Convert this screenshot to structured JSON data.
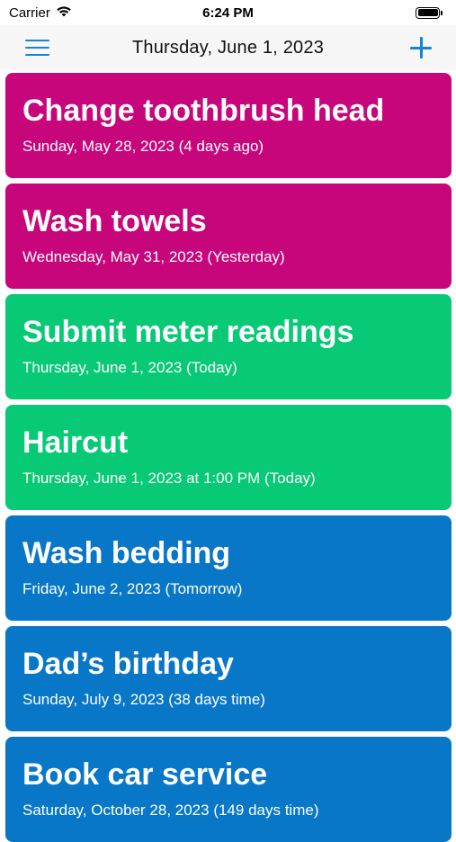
{
  "status_bar": {
    "carrier": "Carrier",
    "time": "6:24 PM",
    "icons": [
      "wifi-icon",
      "battery-icon"
    ]
  },
  "nav": {
    "title": "Thursday, June 1, 2023",
    "left_icon": "menu-icon",
    "right_icon": "plus-icon",
    "accent_color": "#1a82d4"
  },
  "colors": {
    "overdue": "#c8067b",
    "today": "#08c975",
    "upcoming": "#0877c8"
  },
  "tasks": [
    {
      "title": "Change toothbrush head",
      "date": "Sunday, May 28, 2023 (4 days ago)",
      "color": "#c8067b"
    },
    {
      "title": "Wash towels",
      "date": "Wednesday, May 31, 2023 (Yesterday)",
      "color": "#c8067b"
    },
    {
      "title": "Submit meter readings",
      "date": "Thursday, June 1, 2023 (Today)",
      "color": "#08c975"
    },
    {
      "title": "Haircut",
      "date": "Thursday, June 1, 2023 at 1:00 PM (Today)",
      "color": "#08c975"
    },
    {
      "title": "Wash bedding",
      "date": "Friday, June 2, 2023 (Tomorrow)",
      "color": "#0877c8"
    },
    {
      "title": "Dad’s birthday",
      "date": "Sunday, July 9, 2023 (38 days time)",
      "color": "#0877c8"
    },
    {
      "title": "Book car service",
      "date": "Saturday, October 28, 2023 (149 days time)",
      "color": "#0877c8"
    }
  ]
}
